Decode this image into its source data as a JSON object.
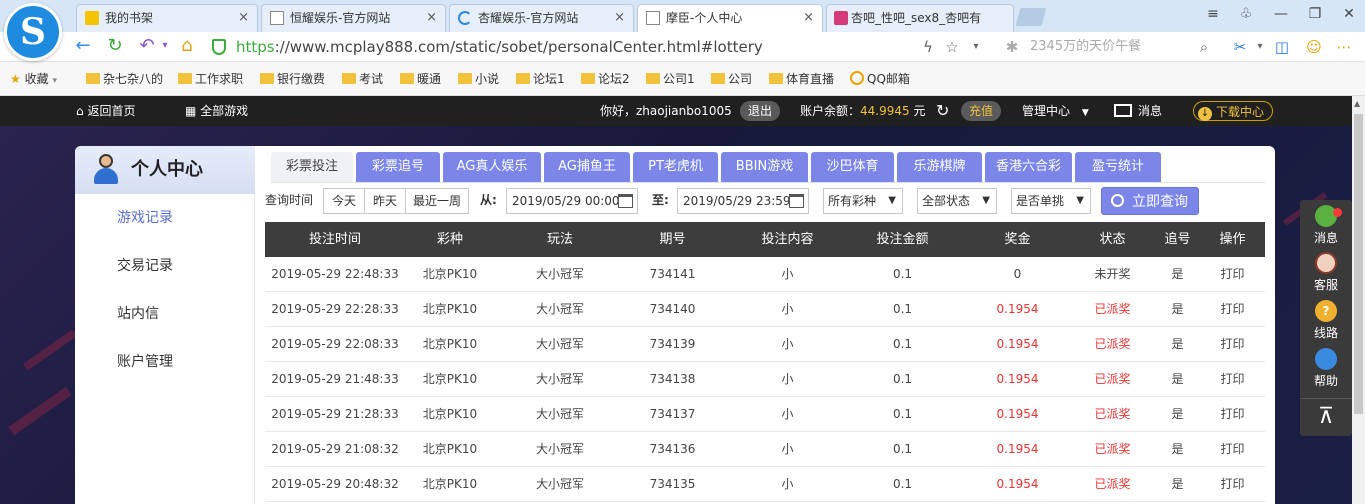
{
  "browser": {
    "tabs": [
      {
        "title": "我的书架",
        "close": "×"
      },
      {
        "title": "恒耀娱乐-官方网站",
        "close": "×"
      },
      {
        "title": "杏耀娱乐-官方网站",
        "close": "×"
      },
      {
        "title": "摩臣-个人中心",
        "close": "×",
        "active": true
      },
      {
        "title": "杏吧_性吧_sex8_杏吧有"
      }
    ],
    "logo": "S",
    "url": "https://www.mcplay888.com/static/sobet/personalCenter.html#lottery",
    "url_scheme": "https",
    "url_rest": "://www.mcplay888.com/static/sobet/personalCenter.html#lottery",
    "search_hint": "2345万的天价午餐",
    "bookmarks": [
      "收藏",
      "杂七杂八的",
      "工作求职",
      "银行缴费",
      "考试",
      "暖通",
      "小说",
      "论坛1",
      "论坛2",
      "公司1",
      "公司",
      "体育直播",
      "QQ邮箱"
    ]
  },
  "site_header": {
    "home": "返回首页",
    "all_games": "全部游戏",
    "greeting": "你好，zhaojianbo1005",
    "logout": "退出",
    "balance_label": "账户余额：",
    "balance": "44.9945",
    "currency": "元",
    "recharge": "充值",
    "manage": "管理中心",
    "messages": "消息",
    "download": "下载中心"
  },
  "sidebar": {
    "title": "个人中心",
    "items": [
      {
        "label": "游戏记录",
        "active": true
      },
      {
        "label": "交易记录"
      },
      {
        "label": "站内信"
      },
      {
        "label": "账户管理"
      }
    ]
  },
  "game_tabs": [
    "彩票投注",
    "彩票追号",
    "AG真人娱乐",
    "AG捕鱼王",
    "PT老虎机",
    "BBIN游戏",
    "沙巴体育",
    "乐游棋牌",
    "香港六合彩",
    "盈亏统计"
  ],
  "filter": {
    "query_time_label": "查询时间",
    "today": "今天",
    "yesterday": "昨天",
    "last_week": "最近一周",
    "from_label": "从:",
    "from": "2019/05/29 00:00",
    "to_label": "至:",
    "to": "2019/05/29 23:59",
    "lottery_select": "所有彩种",
    "status_select": "全部状态",
    "single_select": "是否单挑",
    "query_button": "立即查询"
  },
  "table": {
    "headers": [
      "投注时间",
      "彩种",
      "玩法",
      "期号",
      "投注内容",
      "投注金额",
      "奖金",
      "状态",
      "追号",
      "操作"
    ],
    "rows": [
      [
        "2019-05-29 22:48:33",
        "北京PK10",
        "大小冠军",
        "734141",
        "小",
        "0.1",
        "0",
        "未开奖",
        "是",
        "打印"
      ],
      [
        "2019-05-29 22:28:33",
        "北京PK10",
        "大小冠军",
        "734140",
        "小",
        "0.1",
        "0.1954",
        "已派奖",
        "是",
        "打印"
      ],
      [
        "2019-05-29 22:08:33",
        "北京PK10",
        "大小冠军",
        "734139",
        "小",
        "0.1",
        "0.1954",
        "已派奖",
        "是",
        "打印"
      ],
      [
        "2019-05-29 21:48:33",
        "北京PK10",
        "大小冠军",
        "734138",
        "小",
        "0.1",
        "0.1954",
        "已派奖",
        "是",
        "打印"
      ],
      [
        "2019-05-29 21:28:33",
        "北京PK10",
        "大小冠军",
        "734137",
        "小",
        "0.1",
        "0.1954",
        "已派奖",
        "是",
        "打印"
      ],
      [
        "2019-05-29 21:08:32",
        "北京PK10",
        "大小冠军",
        "734136",
        "小",
        "0.1",
        "0.1954",
        "已派奖",
        "是",
        "打印"
      ],
      [
        "2019-05-29 20:48:32",
        "北京PK10",
        "大小冠军",
        "734135",
        "小",
        "0.1",
        "0.1954",
        "已派奖",
        "是",
        "打印"
      ]
    ]
  },
  "float_bar": {
    "items": [
      "消息",
      "客服",
      "线路",
      "帮助"
    ],
    "top_icon": "⊼"
  },
  "colors": {
    "accent": "#7b86e8",
    "header_bg": "#202020",
    "table_head": "#3d3d3d",
    "prize_red": "#e33333"
  }
}
